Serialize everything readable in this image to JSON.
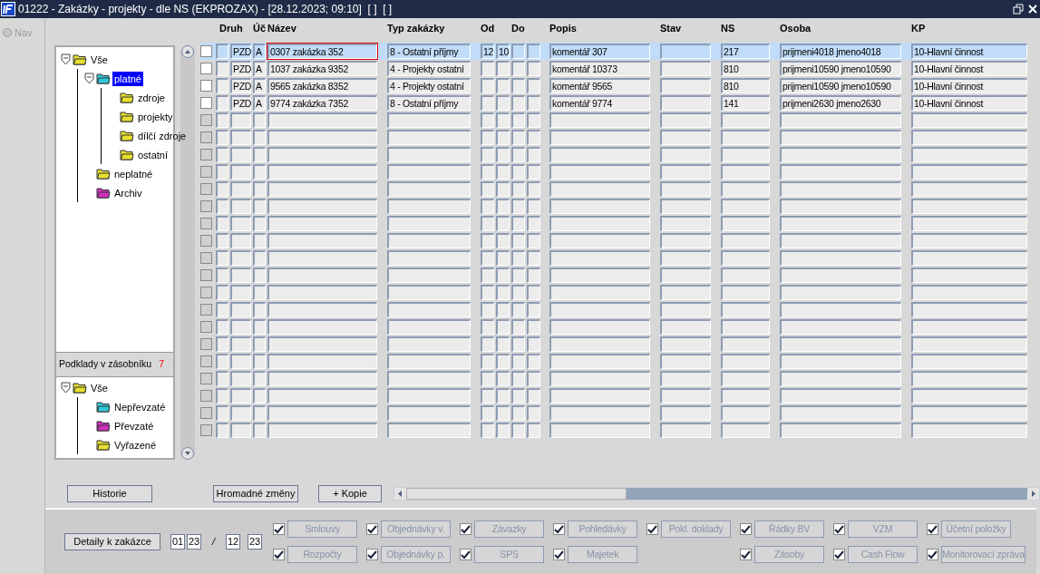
{
  "window": {
    "title": "01222 - Zakázky - projekty - dle NS (EKPROZAX) - [28.12.2023; 09:10]  [ ]  [ ]"
  },
  "nav": {
    "label": "Nav",
    "selected": false
  },
  "tree": [
    {
      "label": "Vše",
      "color": "#e8e030",
      "selected": false,
      "expanded": true,
      "children": [
        {
          "label": "platné",
          "color": "#30c8d8",
          "selected": true,
          "expanded": true,
          "children": [
            {
              "label": "zdroje",
              "color": "#e8e030",
              "selected": false
            },
            {
              "label": "projekty",
              "color": "#e8e030",
              "selected": false
            },
            {
              "label": "dílčí zdroje",
              "color": "#e8e030",
              "selected": false
            },
            {
              "label": "ostatní",
              "color": "#e8e030",
              "selected": false
            }
          ]
        },
        {
          "label": "neplatné",
          "color": "#e8e030",
          "selected": false
        },
        {
          "label": "Archiv",
          "color": "#d030c0",
          "selected": false
        }
      ]
    }
  ],
  "stack": {
    "label": "Podklady v zásobníku",
    "count": "7"
  },
  "stack_tree": [
    {
      "label": "Vše",
      "color": "#e8e030",
      "selected": false,
      "expanded": true,
      "children": [
        {
          "label": "Nepřevzaté",
          "color": "#30c8d8",
          "selected": false
        },
        {
          "label": "Převzaté",
          "color": "#d030c0",
          "selected": false
        },
        {
          "label": "Vyřazené",
          "color": "#e8e030",
          "selected": false
        }
      ]
    }
  ],
  "table": {
    "columns": [
      "",
      "Druh",
      "Úč",
      "Název",
      "Typ zakázky",
      "Od",
      "",
      "Do",
      "",
      "Popis",
      "Stav",
      "NS",
      "Osoba",
      "KP"
    ],
    "rows": [
      {
        "selected": true,
        "checked": false,
        "cells": [
          null,
          "PZD",
          "A",
          "0307 zakázka 352",
          "8 - Ostatní příjmy",
          "12",
          "10",
          null,
          null,
          "komentář 307",
          null,
          "217",
          "prijmeni4018 jmeno4018",
          "10-Hlavní činnost"
        ]
      },
      {
        "selected": false,
        "checked": false,
        "cells": [
          null,
          "PZD",
          "A",
          "1037 zakázka 9352",
          "4 - Projekty ostatní",
          null,
          null,
          null,
          null,
          "komentář 10373",
          null,
          "810",
          "prijmeni10590 jmeno10590",
          "10-Hlavní činnost"
        ]
      },
      {
        "selected": false,
        "checked": false,
        "cells": [
          null,
          "PZD",
          "A",
          "9565 zakázka 8352",
          "4 - Projekty ostatní",
          null,
          null,
          null,
          null,
          "komentář 9565",
          null,
          "810",
          "prijmeni10590 jmeno10590",
          "10-Hlavní činnost"
        ]
      },
      {
        "selected": false,
        "checked": false,
        "cells": [
          null,
          "PZD",
          "A",
          "9774 zakázka 7352",
          "8 - Ostatní příjmy",
          null,
          null,
          null,
          null,
          "komentář 9774",
          null,
          "141",
          "prijmeni2630 jmeno2630",
          "10-Hlavní činnost"
        ]
      }
    ],
    "blank_rows": [
      {
        "checked": false,
        "disabled": true
      },
      {
        "checked": false,
        "disabled": true
      },
      {
        "checked": false,
        "disabled": true
      },
      {
        "checked": false,
        "disabled": true
      },
      {
        "checked": false,
        "disabled": true
      },
      {
        "checked": false,
        "disabled": true
      },
      {
        "checked": false,
        "disabled": true
      },
      {
        "checked": false,
        "disabled": true
      },
      {
        "checked": false,
        "disabled": true
      },
      {
        "checked": false,
        "disabled": true
      },
      {
        "checked": false,
        "disabled": true
      },
      {
        "checked": false,
        "disabled": true
      },
      {
        "checked": false,
        "disabled": true
      },
      {
        "checked": false,
        "disabled": true
      },
      {
        "checked": false,
        "disabled": true
      },
      {
        "checked": false,
        "disabled": true
      },
      {
        "checked": false,
        "disabled": true
      },
      {
        "checked": false,
        "disabled": true
      },
      {
        "checked": false,
        "disabled": true
      }
    ]
  },
  "buttons": [
    "Historie",
    "Hromadné změny",
    "+ Kopie"
  ],
  "details_button": "Detaily k zakázce",
  "period": {
    "from_month": "01",
    "from_year": "23",
    "separator": "/",
    "to_month": "12",
    "to_year": "23"
  },
  "toggles": [
    {
      "top": {
        "label": "Smlouvy",
        "checked": true,
        "disabled": true
      },
      "bottom": {
        "label": "Rozpočty",
        "checked": true,
        "disabled": true
      }
    },
    {
      "top": {
        "label": "Objednávky v.",
        "checked": true,
        "disabled": true
      },
      "bottom": {
        "label": "Objednávky p.",
        "checked": true,
        "disabled": true
      }
    },
    {
      "top": {
        "label": "Závazky",
        "checked": true,
        "disabled": true
      },
      "bottom": {
        "label": "SPS",
        "checked": true,
        "disabled": true
      }
    },
    {
      "top": {
        "label": "Pohledávky",
        "checked": true,
        "disabled": true
      },
      "bottom": {
        "label": "Majetek",
        "checked": true,
        "disabled": true
      }
    },
    {
      "top": {
        "label": "Pokl. doklady",
        "checked": true,
        "disabled": true
      }
    },
    {
      "top": {
        "label": "Řádky BV",
        "checked": true,
        "disabled": true
      },
      "bottom": {
        "label": "Zásoby",
        "checked": true,
        "disabled": true
      }
    },
    {
      "top": {
        "label": "VZM",
        "checked": true,
        "disabled": true
      },
      "bottom": {
        "label": "Cash Flow",
        "checked": true,
        "disabled": true
      }
    },
    {
      "top": {
        "label": "Účetní položky",
        "checked": true,
        "disabled": true
      },
      "bottom": {
        "label": "Monitorovací zpráva",
        "checked": true,
        "disabled": true
      }
    }
  ]
}
